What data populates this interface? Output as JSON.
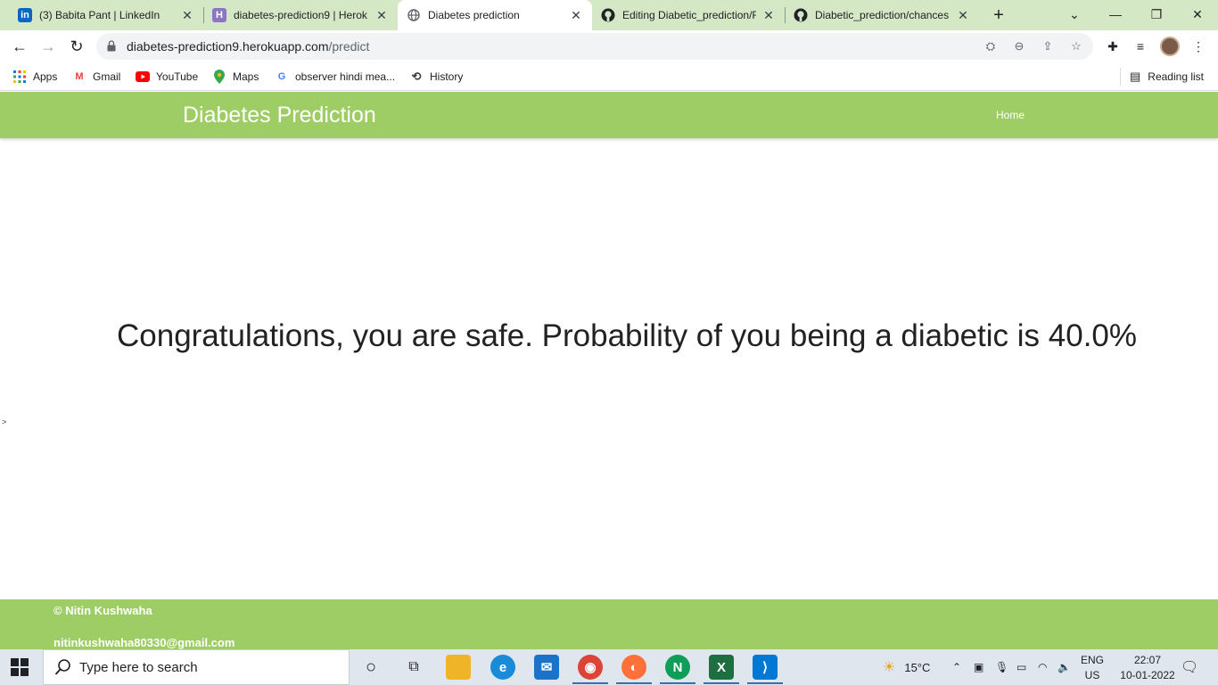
{
  "browser": {
    "tabs": [
      {
        "title": "(3) Babita Pant | LinkedIn",
        "icon": "linkedin-icon",
        "active": false
      },
      {
        "title": "diabetes-prediction9 | Heroku",
        "icon": "heroku-icon",
        "active": false
      },
      {
        "title": "Diabetes prediction",
        "icon": "globe-icon",
        "active": true
      },
      {
        "title": "Editing Diabetic_prediction/R",
        "icon": "github-icon",
        "active": false
      },
      {
        "title": "Diabetic_prediction/chances",
        "icon": "github-icon",
        "active": false
      }
    ],
    "url_host": "diabetes-prediction9.herokuapp.com",
    "url_path": "/predict",
    "bookmarks": [
      {
        "label": "Apps",
        "icon": "apps-grid-icon"
      },
      {
        "label": "Gmail",
        "icon": "gmail-icon"
      },
      {
        "label": "YouTube",
        "icon": "youtube-icon"
      },
      {
        "label": "Maps",
        "icon": "maps-pin-icon"
      },
      {
        "label": "observer hindi mea...",
        "icon": "google-icon"
      },
      {
        "label": "History",
        "icon": "history-icon"
      }
    ],
    "reading_list": "Reading list"
  },
  "page": {
    "brand": "Diabetes Prediction",
    "nav_home": "Home",
    "result_text": "Congratulations, you are safe. Probability of you being a diabetic is 40.0%",
    "stray_char": ">",
    "footer_copyright": "© Nitin Kushwaha",
    "footer_email": "nitinkushwaha80330@gmail.com"
  },
  "taskbar": {
    "search_placeholder": "Type here to search",
    "weather": "15°C",
    "lang_top": "ENG",
    "lang_bottom": "US",
    "time": "22:07",
    "date": "10-01-2022"
  },
  "colors": {
    "accent_green": "#9ecd65",
    "tab_strip": "#d5e8c6"
  }
}
